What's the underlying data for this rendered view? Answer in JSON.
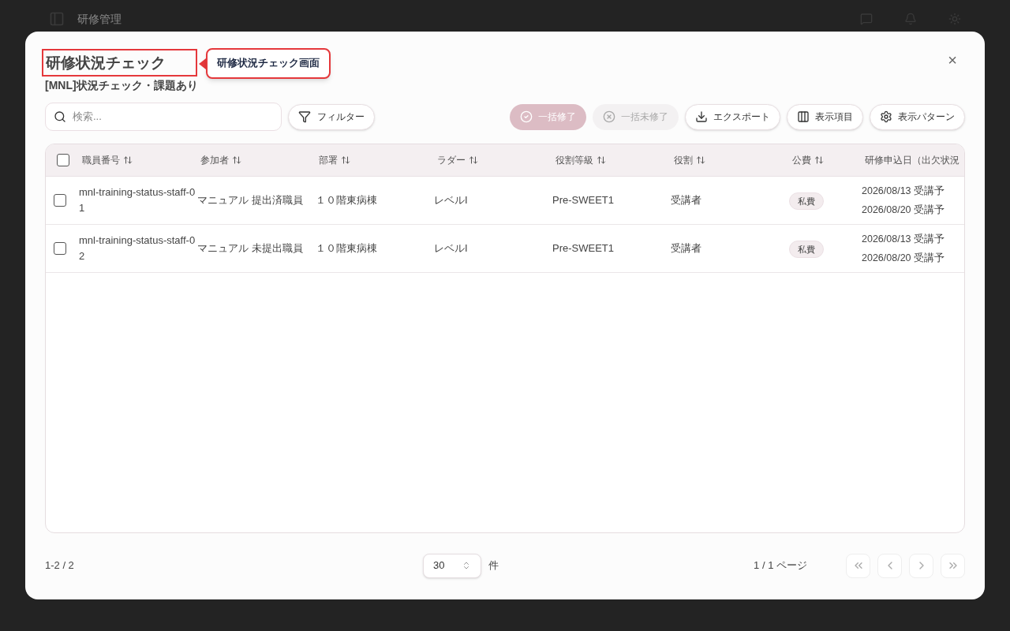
{
  "background": {
    "app_title": "研修管理"
  },
  "dialog": {
    "title": "研修状況チェック",
    "subtitle": "[MNL]状況チェック・課題あり",
    "close": "×"
  },
  "annotation": {
    "label": "研修状況チェック画面"
  },
  "toolbar": {
    "search": {
      "placeholder": "検索..."
    },
    "filter": "フィルター",
    "actions": [
      {
        "kind": "complete",
        "label": "一括修了",
        "disabled": true
      },
      {
        "kind": "incomplete",
        "label": "一括未修了",
        "disabled": true
      },
      {
        "kind": "export",
        "label": "エクスポート",
        "disabled": false
      },
      {
        "kind": "columns",
        "label": "表示項目",
        "disabled": false
      },
      {
        "kind": "settings",
        "label": "表示パターン",
        "disabled": false
      }
    ]
  },
  "table": {
    "columns": [
      {
        "label": "職員番号",
        "sortable": true
      },
      {
        "label": "参加者",
        "sortable": true
      },
      {
        "label": "部署",
        "sortable": true
      },
      {
        "label": "ラダー",
        "sortable": true
      },
      {
        "label": "役割等級",
        "sortable": true
      },
      {
        "label": "役割",
        "sortable": true
      },
      {
        "label": "公費",
        "sortable": true
      },
      {
        "label": "研修申込日（出欠状況"
      }
    ],
    "all_checked": false,
    "rows": [
      {
        "checked": false,
        "cells": [
          "mnl-training-status-staff-01",
          "マニュアル 提出済職員",
          "１０階東病棟",
          "レベルI",
          "Pre-SWEET1",
          "受講者",
          "私費"
        ],
        "dates": [
          "2026/08/13 受講予",
          "2026/08/20 受講予"
        ]
      },
      {
        "checked": false,
        "cells": [
          "mnl-training-status-staff-02",
          "マニュアル 未提出職員",
          "１０階東病棟",
          "レベルI",
          "Pre-SWEET1",
          "受講者",
          "私費"
        ],
        "dates": [
          "2026/08/13 受講予",
          "2026/08/20 受講予"
        ]
      }
    ]
  },
  "footer": {
    "range": "1-2 / 2",
    "page_size": "30",
    "unit": "件",
    "page_info": "1 / 1 ページ",
    "pager": [
      {
        "kind": "first",
        "disabled": true
      },
      {
        "kind": "prev",
        "disabled": true
      },
      {
        "kind": "next",
        "disabled": true
      },
      {
        "kind": "last",
        "disabled": true
      }
    ]
  }
}
